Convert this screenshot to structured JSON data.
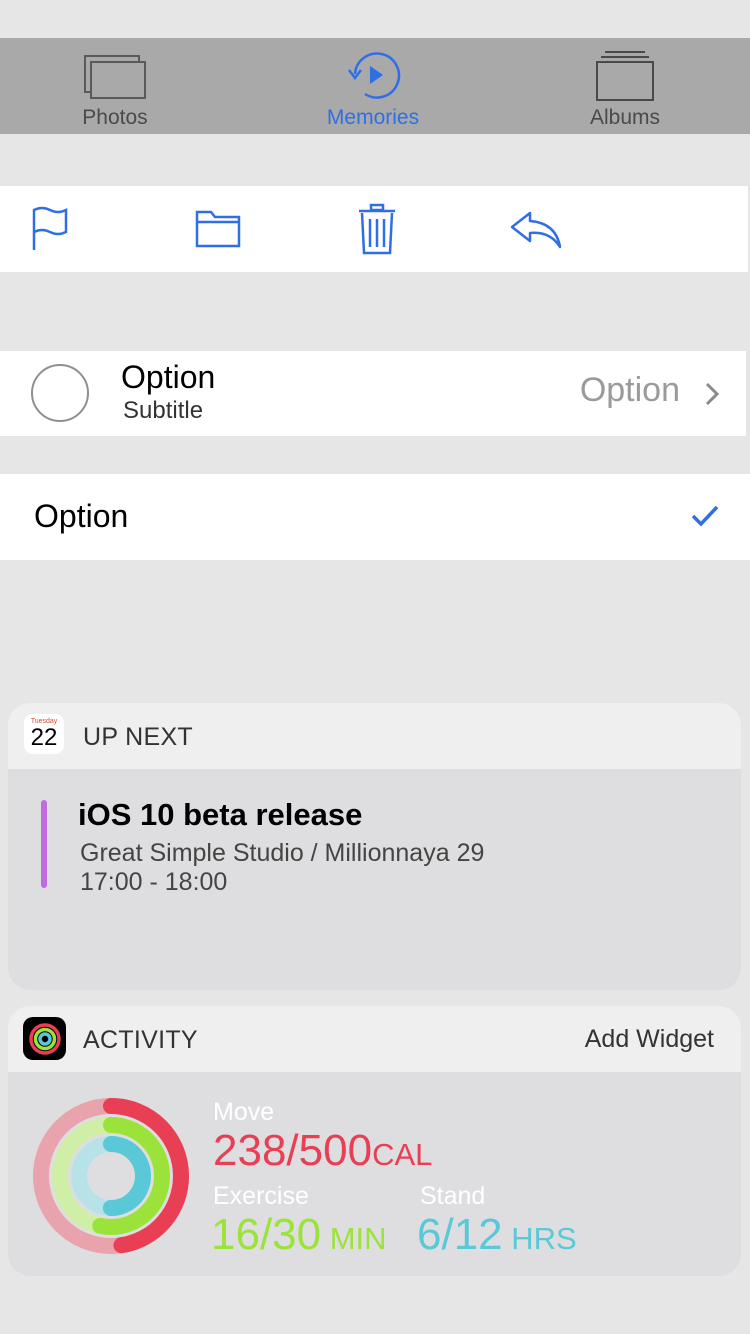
{
  "tabbar": {
    "tabs": [
      {
        "label": "Photos",
        "icon": "photos-icon",
        "active": false
      },
      {
        "label": "Memories",
        "icon": "memories-icon",
        "active": true
      },
      {
        "label": "Albums",
        "icon": "albums-icon",
        "active": false
      }
    ]
  },
  "toolbar": {
    "icons": [
      "flag-icon",
      "folder-icon",
      "trash-icon",
      "reply-icon"
    ]
  },
  "option_row": {
    "title": "Option",
    "subtitle": "Subtitle",
    "detail": "Option"
  },
  "checked_row": {
    "title": "Option",
    "checked": true
  },
  "up_next_widget": {
    "calendar_day_name": "Tuesday",
    "calendar_day_number": "22",
    "title": "UP NEXT",
    "event": {
      "title": "iOS 10 beta release",
      "location": "Great Simple Studio / Millionnaya 29",
      "time": "17:00 - 18:00"
    }
  },
  "activity_widget": {
    "title": "ACTIVITY",
    "add_widget_label": "Add Widget",
    "move": {
      "label": "Move",
      "value": "238/500",
      "unit": "CAL",
      "progress": 0.476
    },
    "exercise": {
      "label": "Exercise",
      "value": "16/30",
      "unit": " MIN",
      "progress": 0.533
    },
    "stand": {
      "label": "Stand",
      "value": "6/12",
      "unit": " HRS",
      "progress": 0.5
    }
  },
  "colors": {
    "accent": "#2f6fe6",
    "move": "#e83f55",
    "exercise": "#9be33a",
    "stand": "#5ac8d6",
    "event_bar": "#c06be0"
  }
}
